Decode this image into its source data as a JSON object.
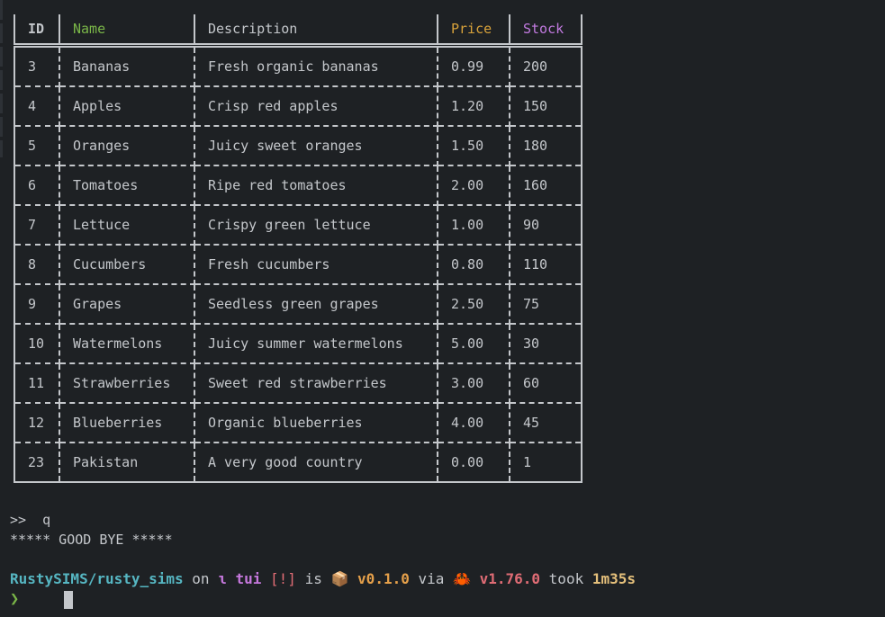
{
  "table": {
    "headers": {
      "id": "ID",
      "name": "Name",
      "description": "Description",
      "price": "Price",
      "stock": "Stock"
    },
    "rows": [
      {
        "id": "3",
        "name": "Bananas",
        "description": "Fresh organic bananas",
        "price": "0.99",
        "stock": "200"
      },
      {
        "id": "4",
        "name": "Apples",
        "description": "Crisp red apples",
        "price": "1.20",
        "stock": "150"
      },
      {
        "id": "5",
        "name": "Oranges",
        "description": "Juicy sweet oranges",
        "price": "1.50",
        "stock": "180"
      },
      {
        "id": "6",
        "name": "Tomatoes",
        "description": "Ripe red tomatoes",
        "price": "2.00",
        "stock": "160"
      },
      {
        "id": "7",
        "name": "Lettuce",
        "description": "Crispy green lettuce",
        "price": "1.00",
        "stock": "90"
      },
      {
        "id": "8",
        "name": "Cucumbers",
        "description": "Fresh cucumbers",
        "price": "0.80",
        "stock": "110"
      },
      {
        "id": "9",
        "name": "Grapes",
        "description": "Seedless green grapes",
        "price": "2.50",
        "stock": "75"
      },
      {
        "id": "10",
        "name": "Watermelons",
        "description": "Juicy summer watermelons",
        "price": "5.00",
        "stock": "30"
      },
      {
        "id": "11",
        "name": "Strawberries",
        "description": "Sweet red strawberries",
        "price": "3.00",
        "stock": "60"
      },
      {
        "id": "12",
        "name": "Blueberries",
        "description": "Organic blueberries",
        "price": "4.00",
        "stock": "45"
      },
      {
        "id": "23",
        "name": "Pakistan",
        "description": "A very good country",
        "price": "0.00",
        "stock": "1"
      }
    ]
  },
  "terminal": {
    "prompt_symbol": ">>",
    "command": "q",
    "goodbye": "***** GOOD BYE *****",
    "status": {
      "path": "RustySIMS/rusty_sims",
      "on": "on",
      "branch_icon": "ɩ",
      "branch": "tui",
      "flags": "[!]",
      "is": "is",
      "package_icon": "📦",
      "version": "v0.1.0",
      "via": "via",
      "rust_icon": "🦀",
      "rust_version": "v1.76.0",
      "took": "took",
      "duration": "1m35s"
    },
    "chevron": "❯"
  },
  "colors": {
    "background": "#1e2124",
    "text": "#c4c7cb",
    "name_header": "#7ab648",
    "price_header": "#d8a23a",
    "stock_header": "#c27ae0",
    "path": "#56b6c2",
    "branch": "#c678dd",
    "version": "#e5a04a",
    "duration": "#e5c07b"
  }
}
